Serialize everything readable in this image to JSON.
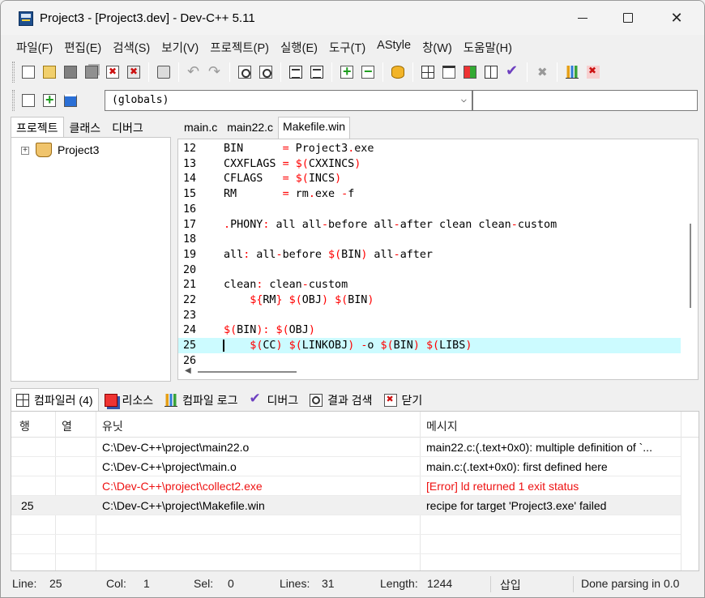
{
  "window": {
    "title": "Project3 - [Project3.dev] - Dev-C++ 5.11"
  },
  "menu": [
    "파일(F)",
    "편집(E)",
    "검색(S)",
    "보기(V)",
    "프로젝트(P)",
    "실행(E)",
    "도구(T)",
    "AStyle",
    "창(W)",
    "도움말(H)"
  ],
  "combo": {
    "globals": "(globals)"
  },
  "left_tabs": [
    "프로젝트",
    "클래스",
    "디버그"
  ],
  "tree": {
    "expander": "+",
    "project": "Project3"
  },
  "editor_tabs": [
    "main.c",
    "main22.c",
    "Makefile.win"
  ],
  "code_lines": [
    {
      "ln": "12",
      "text": "BIN      = Project3.exe"
    },
    {
      "ln": "13",
      "text": "CXXFLAGS = $(CXXINCS)"
    },
    {
      "ln": "14",
      "text": "CFLAGS   = $(INCS)"
    },
    {
      "ln": "15",
      "text": "RM       = rm.exe -f"
    },
    {
      "ln": "16",
      "text": ""
    },
    {
      "ln": "17",
      "text": ".PHONY: all all-before all-after clean clean-custom"
    },
    {
      "ln": "18",
      "text": ""
    },
    {
      "ln": "19",
      "text": "all: all-before $(BIN) all-after"
    },
    {
      "ln": "20",
      "text": ""
    },
    {
      "ln": "21",
      "text": "clean: clean-custom"
    },
    {
      "ln": "22",
      "text": "    ${RM} $(OBJ) $(BIN)"
    },
    {
      "ln": "23",
      "text": ""
    },
    {
      "ln": "24",
      "text": "$(BIN): $(OBJ)"
    },
    {
      "ln": "25",
      "text": "    $(CC) $(LINKOBJ) -o $(BIN) $(LIBS)"
    },
    {
      "ln": "26",
      "text": ""
    }
  ],
  "bottom_tabs": [
    "컴파일러 (4)",
    "리소스",
    "컴파일 로그",
    "디버그",
    "결과 검색",
    "닫기"
  ],
  "grid": {
    "headers": [
      "행",
      "열",
      "유닛",
      "메시지"
    ],
    "rows": [
      {
        "line": "",
        "col": "",
        "unit": "C:\\Dev-C++\\project\\main22.o",
        "msg": "main22.c:(.text+0x0): multiple definition of `..."
      },
      {
        "line": "",
        "col": "",
        "unit": "C:\\Dev-C++\\project\\main.o",
        "msg": "main.c:(.text+0x0): first defined here"
      },
      {
        "line": "",
        "col": "",
        "unit": "C:\\Dev-C++\\project\\collect2.exe",
        "msg": "[Error] ld returned 1 exit status"
      },
      {
        "line": "25",
        "col": "",
        "unit": "C:\\Dev-C++\\project\\Makefile.win",
        "msg": "recipe for target 'Project3.exe' failed"
      }
    ]
  },
  "status": {
    "line_label": "Line:",
    "line": "25",
    "col_label": "Col:",
    "col": "1",
    "sel_label": "Sel:",
    "sel": "0",
    "lines_label": "Lines:",
    "lines": "31",
    "length_label": "Length:",
    "length": "1244",
    "mode": "삽입",
    "message": "Done parsing in 0.0"
  },
  "colors": {
    "current_line": "#ccfbff",
    "error_text": "#ee1111",
    "operator": "#ff0000"
  }
}
